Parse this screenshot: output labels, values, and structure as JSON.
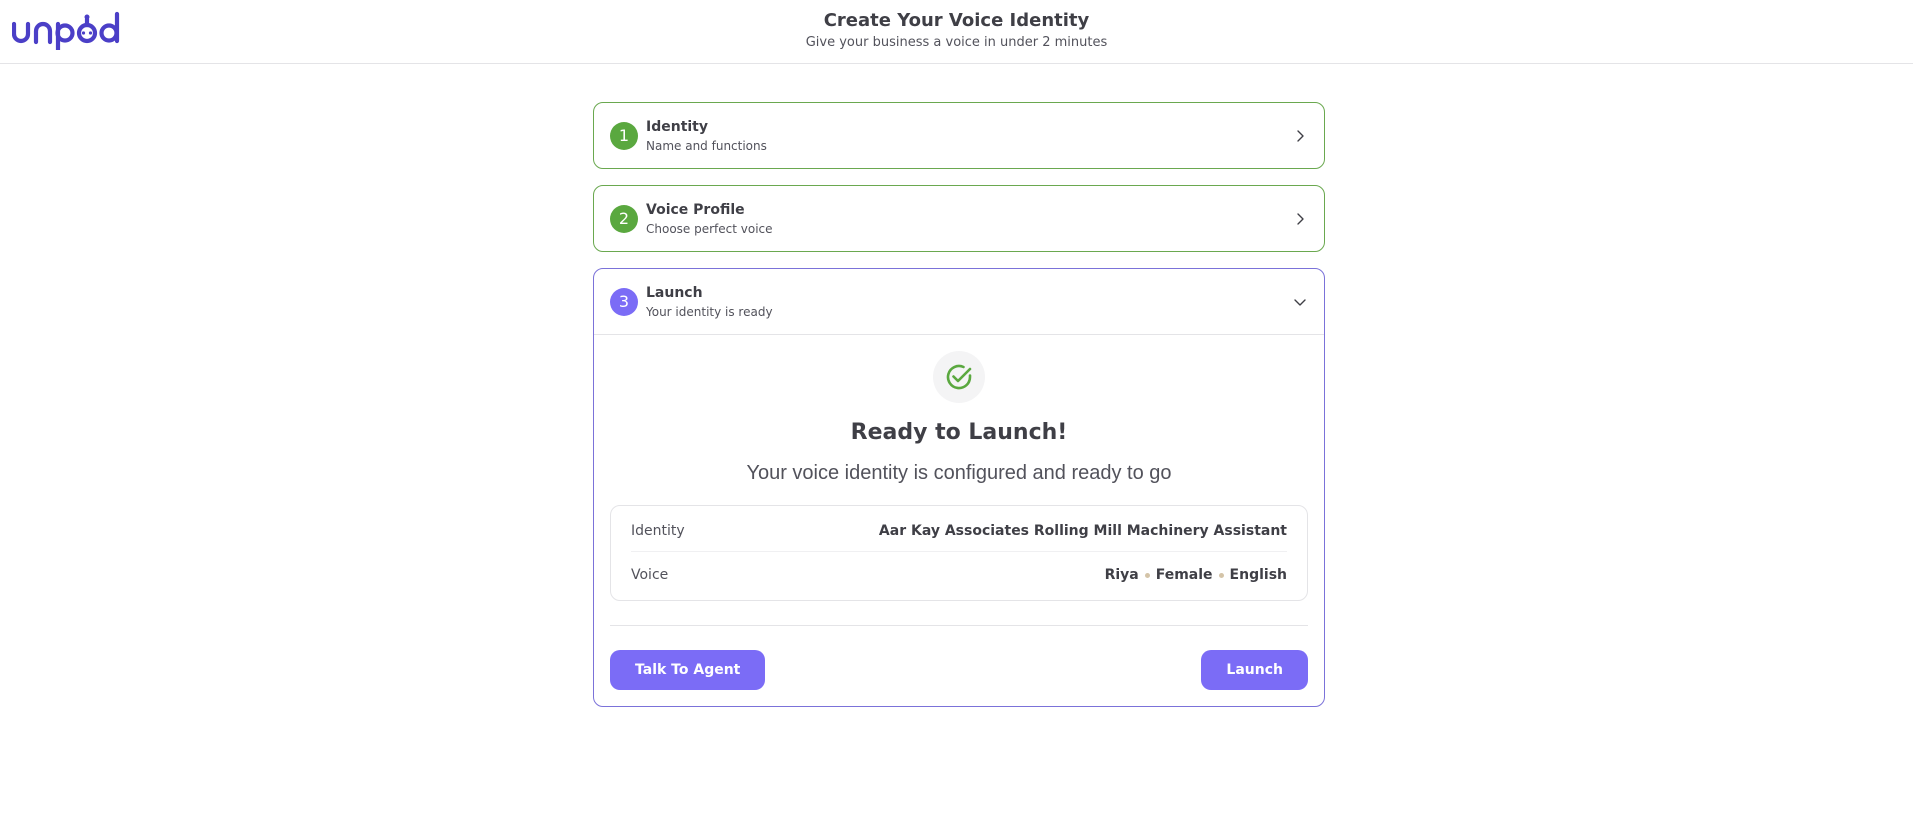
{
  "header": {
    "logo_text": "unpod",
    "title": "Create Your Voice Identity",
    "subtitle": "Give your business a voice in under 2 minutes"
  },
  "steps": [
    {
      "number": "1",
      "title": "Identity",
      "subtitle": "Name and functions",
      "state": "completed"
    },
    {
      "number": "2",
      "title": "Voice Profile",
      "subtitle": "Choose perfect voice",
      "state": "completed"
    },
    {
      "number": "3",
      "title": "Launch",
      "subtitle": "Your identity is ready",
      "state": "active"
    }
  ],
  "launch": {
    "ready_title": "Ready to Launch!",
    "ready_subtitle": "Your voice identity is configured and ready to go",
    "summary": {
      "identity_label": "Identity",
      "identity_value": "Aar Kay Associates Rolling Mill Machinery Assistant",
      "voice_label": "Voice",
      "voice_name": "Riya",
      "voice_gender": "Female",
      "voice_language": "English"
    },
    "talk_button": "Talk To Agent",
    "launch_button": "Launch"
  },
  "colors": {
    "brand": "#4b3fc7",
    "accent": "#7b6cf6",
    "success": "#5aa83f"
  }
}
